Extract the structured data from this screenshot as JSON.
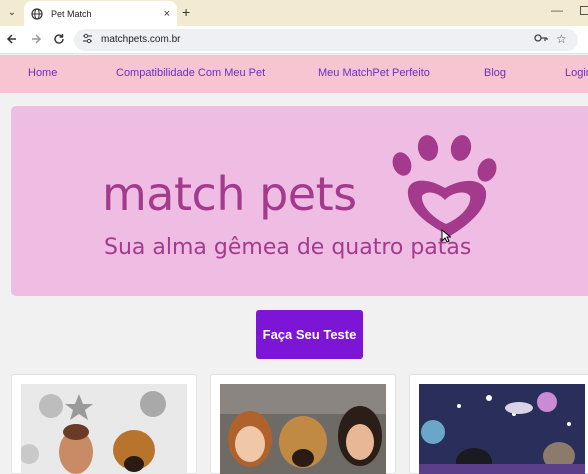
{
  "browser": {
    "tab_title": "Pet Match",
    "tab_close": "×",
    "new_tab": "+",
    "url": "matchpets.com.br",
    "minimize": "—"
  },
  "site_nav": {
    "items": [
      {
        "label": "Home"
      },
      {
        "label": "Compatibilidade Com Meu Pet"
      },
      {
        "label": "Meu MatchPet Perfeito"
      },
      {
        "label": "Blog"
      },
      {
        "label": "Login"
      }
    ]
  },
  "hero": {
    "logo_text": "match pets",
    "tagline": "Sua alma gêmea de quatro patas"
  },
  "cta": {
    "label": "Faça Seu Teste"
  },
  "colors": {
    "nav_bg": "#f7c5d1",
    "nav_link": "#6b2fc1",
    "hero_bg": "#efbde4",
    "brand_magenta": "#a33a8c",
    "cta_bg": "#7c15d6"
  },
  "icons": [
    "chevron-down-icon",
    "globe-icon",
    "close-icon",
    "plus-icon",
    "back-icon",
    "forward-icon",
    "reload-icon",
    "site-info-icon",
    "key-icon",
    "star-icon",
    "paw-heart-icon",
    "cursor-icon"
  ]
}
